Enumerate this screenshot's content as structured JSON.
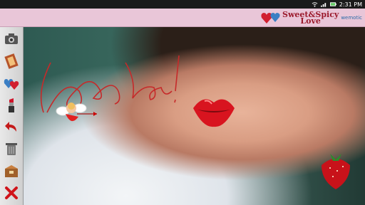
{
  "status_bar": {
    "time": "2:31 PM",
    "icons": [
      "wifi-icon",
      "signal-icon",
      "battery-icon"
    ]
  },
  "brand": {
    "title_line1": "Sweet&Spicy",
    "title_line2": "Love",
    "publisher": "wemotic"
  },
  "canvas": {
    "handwriting": "I love you!",
    "stickers": [
      "cupid-sticker",
      "kiss-lips-sticker",
      "strawberry-sticker"
    ]
  },
  "toolbar": {
    "tools": [
      {
        "name": "camera-tool",
        "icon": "camera-icon"
      },
      {
        "name": "filmstrip-tool",
        "icon": "film-icon"
      },
      {
        "name": "hearts-tool",
        "icon": "hearts-icon"
      },
      {
        "name": "lipstick-tool",
        "icon": "lipstick-icon"
      },
      {
        "name": "undo-tool",
        "icon": "undo-arrow-icon"
      },
      {
        "name": "trash-tool",
        "icon": "trash-icon"
      },
      {
        "name": "save-tool",
        "icon": "box-icon"
      },
      {
        "name": "close-tool",
        "icon": "close-icon"
      }
    ]
  },
  "colors": {
    "banner": "#e9c6d8",
    "brand": "#9b1a2c",
    "handwriting": "#c62a2a"
  }
}
